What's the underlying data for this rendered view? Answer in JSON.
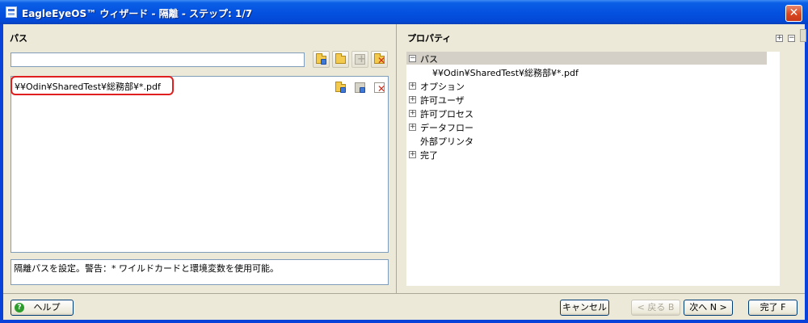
{
  "window": {
    "title": "EagleEyeOS™ ウィザード - 隔離 - ステップ: 1/7",
    "close_label": "✕"
  },
  "left": {
    "path_section_title": "パス",
    "path_input_value": "",
    "toolbar_icons": [
      "folder-add-icon",
      "folder-browse-icon",
      "add-icon",
      "delete-icon"
    ],
    "paths": [
      "¥¥Odin¥SharedTest¥総務部¥*.pdf"
    ],
    "row_icons": [
      "folder-edit-icon",
      "copy-icon",
      "delete-icon"
    ],
    "description": "隔離パスを設定。警告：* ワイルドカードと環境変数を使用可能。"
  },
  "right": {
    "properties_title": "プロパティ",
    "expand_all": "+",
    "collapse_all": "−",
    "tree": [
      {
        "label": "パス",
        "toggle": "−",
        "expanded": true,
        "children": [
          "¥¥Odin¥SharedTest¥総務部¥*.pdf"
        ]
      },
      {
        "label": "オプション",
        "toggle": "+"
      },
      {
        "label": "許可ユーザ",
        "toggle": "+"
      },
      {
        "label": "許可プロセス",
        "toggle": "+"
      },
      {
        "label": "データフロー",
        "toggle": "+"
      },
      {
        "label": "外部プリンタ",
        "toggle": ""
      },
      {
        "label": "完了",
        "toggle": "+"
      }
    ]
  },
  "footer": {
    "help": "ヘルプ",
    "cancel": "キャンセル",
    "back": "< 戻る B",
    "next": "次へ N >",
    "finish": "完了 F"
  },
  "colors": {
    "titlebar": "#0552e0",
    "face": "#ece9d8",
    "highlight_outline": "#e02020"
  }
}
